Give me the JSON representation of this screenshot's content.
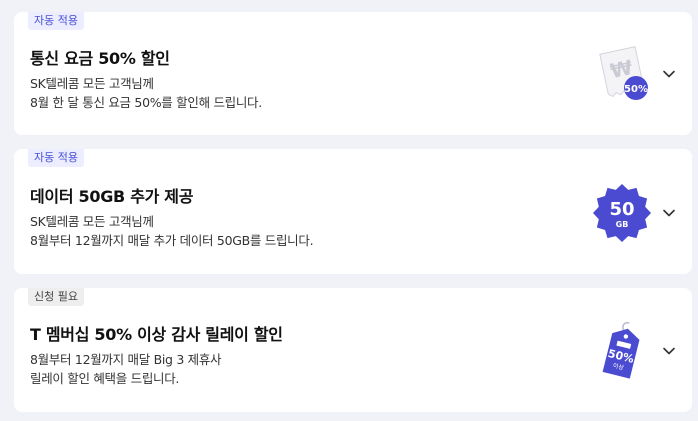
{
  "cards": [
    {
      "badge": "자동 적용",
      "title": "통신 요금 50% 할인",
      "desc_line1": "SK텔레콤 모든 고객님께",
      "desc_line2": "8월 한 달 통신 요금 50%를 할인해 드립니다.",
      "illustration": "receipt-won-50-icon",
      "illustration_label": "50%"
    },
    {
      "badge": "자동 적용",
      "title": "데이터 50GB 추가 제공",
      "desc_line1": "SK텔레콤 모든 고객님께",
      "desc_line2": "8월부터 12월까지 매달 추가 데이터 50GB를 드립니다.",
      "illustration": "data-50gb-badge-icon",
      "illustration_num": "50",
      "illustration_unit": "GB"
    },
    {
      "badge": "신청 필요",
      "title": "T 멤버십 50% 이상 감사 릴레이 할인",
      "desc_line1": "8월부터 12월까지 매달 Big 3 제휴사",
      "desc_line2": "릴레이 할인 혜택을 드립니다.",
      "illustration": "discount-tag-icon",
      "illustration_label": "50%",
      "illustration_sub": "이상"
    }
  ],
  "colors": {
    "accent": "#4a4fd6",
    "badge_auto_bg": "#eceeff",
    "badge_apply_bg": "#eeeeee"
  }
}
